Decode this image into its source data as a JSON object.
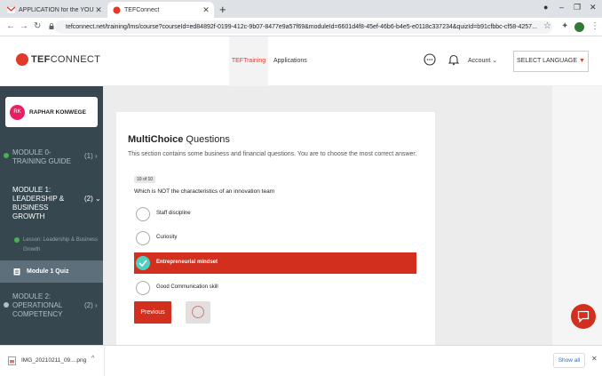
{
  "browser": {
    "tabs": [
      {
        "title": "APPLICATION for the YOUTH EN",
        "active": false
      },
      {
        "title": "TEFConnect",
        "active": true
      }
    ],
    "url": "tefconnect.net/training/lms/course?courseId=ed84892f-0199-412c-9b07-8477e9a57f69&moduleId=6601d4f8-45ef-46b6-b4e5-e0118c337234&quizId=b91cfbbc-cf58-4257..."
  },
  "header": {
    "brand_bold": "TEF",
    "brand_rest": "CONNECT",
    "nav": {
      "training": "TEFTraining",
      "applications": "Applications"
    },
    "account": "Account",
    "language_button": "SELECT LANGUAGE"
  },
  "sidebar": {
    "user": {
      "initials": "RK",
      "name": "RAPHAR KONWEGE"
    },
    "modules": [
      {
        "title": "MODULE 0- TRAINING GUIDE",
        "count": "(1)",
        "completed": true
      },
      {
        "title": "MODULE 1: LEADERSHIP & BUSINESS GROWTH",
        "count": "(2)",
        "completed": false
      },
      {
        "title": "MODULE 2: OPERATIONAL COMPETENCY",
        "count": "(2)",
        "completed": false
      }
    ],
    "lesson": "Lesson: Leadership & Business Growth",
    "quiz": "Module 1 Quiz"
  },
  "quiz": {
    "heading_bold": "MultiChoice",
    "heading_rest": " Questions",
    "description": "This section contains some business and financial questions. You are to choose the most correct answer.",
    "progress": "10 of 10",
    "question": "Which is NOT the characteristics of an innovation team",
    "options": [
      {
        "label": "Staff discipline",
        "selected": false
      },
      {
        "label": "Curiosity",
        "selected": false
      },
      {
        "label": "Entrepreneurial mindset",
        "selected": true
      },
      {
        "label": "Good Communication skill",
        "selected": false
      }
    ],
    "previous_label": "Previous"
  },
  "downloads": {
    "file": "IMG_20210211_09....png",
    "show_all": "Show all"
  },
  "colors": {
    "accent": "#d32f1e",
    "sidebar": "#37474f",
    "check": "#4dd0c1"
  }
}
